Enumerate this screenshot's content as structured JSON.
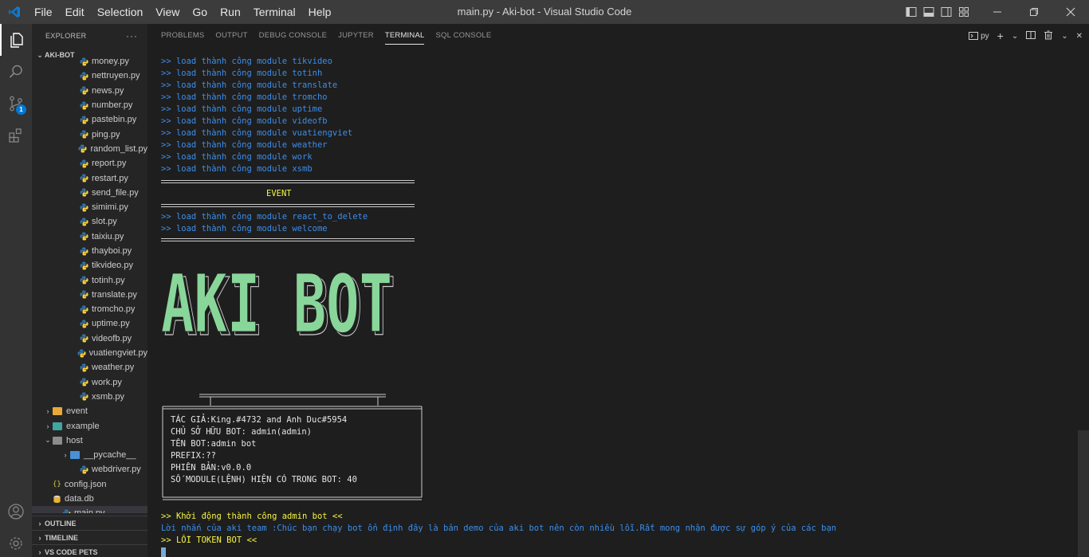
{
  "window": {
    "title": "main.py - Aki-bot - Visual Studio Code",
    "menu": [
      "File",
      "Edit",
      "Selection",
      "View",
      "Go",
      "Run",
      "Terminal",
      "Help"
    ]
  },
  "activity_bar": {
    "scm_badge": "1"
  },
  "sidebar": {
    "header": "EXPLORER",
    "more": "···",
    "project": "AKI-BOT",
    "files": [
      {
        "name": "money.py",
        "type": "py",
        "indent": 2
      },
      {
        "name": "nettruyen.py",
        "type": "py",
        "indent": 2
      },
      {
        "name": "news.py",
        "type": "py",
        "indent": 2
      },
      {
        "name": "number.py",
        "type": "py",
        "indent": 2
      },
      {
        "name": "pastebin.py",
        "type": "py",
        "indent": 2
      },
      {
        "name": "ping.py",
        "type": "py",
        "indent": 2
      },
      {
        "name": "random_list.py",
        "type": "py",
        "indent": 2
      },
      {
        "name": "report.py",
        "type": "py",
        "indent": 2
      },
      {
        "name": "restart.py",
        "type": "py",
        "indent": 2
      },
      {
        "name": "send_file.py",
        "type": "py",
        "indent": 2
      },
      {
        "name": "simimi.py",
        "type": "py",
        "indent": 2
      },
      {
        "name": "slot.py",
        "type": "py",
        "indent": 2
      },
      {
        "name": "taixiu.py",
        "type": "py",
        "indent": 2
      },
      {
        "name": "thayboi.py",
        "type": "py",
        "indent": 2
      },
      {
        "name": "tikvideo.py",
        "type": "py",
        "indent": 2
      },
      {
        "name": "totinh.py",
        "type": "py",
        "indent": 2
      },
      {
        "name": "translate.py",
        "type": "py",
        "indent": 2
      },
      {
        "name": "tromcho.py",
        "type": "py",
        "indent": 2
      },
      {
        "name": "uptime.py",
        "type": "py",
        "indent": 2
      },
      {
        "name": "videofb.py",
        "type": "py",
        "indent": 2
      },
      {
        "name": "vuatiengviet.py",
        "type": "py",
        "indent": 2
      },
      {
        "name": "weather.py",
        "type": "py",
        "indent": 2
      },
      {
        "name": "work.py",
        "type": "py",
        "indent": 2
      },
      {
        "name": "xsmb.py",
        "type": "py",
        "indent": 2
      },
      {
        "name": "event",
        "type": "folder-closed",
        "indent": 1,
        "color": "#e8a93a"
      },
      {
        "name": "example",
        "type": "folder-closed",
        "indent": 1,
        "color": "#3fa6a0"
      },
      {
        "name": "host",
        "type": "folder-open",
        "indent": 1,
        "color": "#8c8c8c"
      },
      {
        "name": "__pycache__",
        "type": "folder-closed",
        "indent": 2,
        "color": "#4a90d9"
      },
      {
        "name": "webdriver.py",
        "type": "py",
        "indent": 2
      },
      {
        "name": "config.json",
        "type": "json",
        "indent": 1
      },
      {
        "name": "data.db",
        "type": "db",
        "indent": 1
      },
      {
        "name": "main.py",
        "type": "py",
        "indent": 1,
        "selected": true
      }
    ],
    "sections": [
      "OUTLINE",
      "TIMELINE",
      "VS CODE PETS"
    ]
  },
  "panel": {
    "tabs": [
      "PROBLEMS",
      "OUTPUT",
      "DEBUG CONSOLE",
      "JUPYTER",
      "TERMINAL",
      "SQL CONSOLE"
    ],
    "active_tab": "TERMINAL",
    "shell_label": "py",
    "actions": {
      "new": "+",
      "dropdown": "⌄",
      "split": "split",
      "trash": "trash",
      "more": "⌄",
      "close": "✕"
    }
  },
  "terminal": {
    "module_lines": [
      ">> load thành công module tikvideo",
      ">> load thành công module totinh",
      ">> load thành công module translate",
      ">> load thành công module tromcho",
      ">> load thành công module uptime",
      ">> load thành công module videofb",
      ">> load thành công module vuatiengviet",
      ">> load thành công module weather",
      ">> load thành công module work",
      ">> load thành công module xsmb"
    ],
    "event_heading": "EVENT",
    "event_lines": [
      ">> load thành công module react_to_delete",
      ">> load thành công module welcome"
    ],
    "banner_text": "AKI BOT",
    "info_lines": [
      "TÁC GIẢ:King.#4732 and Anh Duc#5954",
      "CHỦ SỞ HỮU BOT: admin(admin)",
      "TÊN BOT:admin bot",
      "PREFIX:??",
      "PHIÊN BẢN:v0.0.0",
      "SỐ MODULE(LỆNH) HIỆN CÓ TRONG BOT: 40"
    ],
    "startup_line": ">> Khởi động thành công admin bot <<",
    "message_line": "Lời nhắn của aki team :Chúc bạn chạy bot ổn định đây là bản demo của aki bot nên còn nhiều lỗi.Rất mong nhận được sự góp ý của các bạn",
    "error_line": ">> LỖI TOKEN BOT <<"
  },
  "colors": {
    "banner_green": "#89d69a",
    "cyan_text": "#3b8eea",
    "yellow_text": "#f5f543",
    "python_blue": "#3572a5",
    "python_yellow": "#ffd43b"
  }
}
